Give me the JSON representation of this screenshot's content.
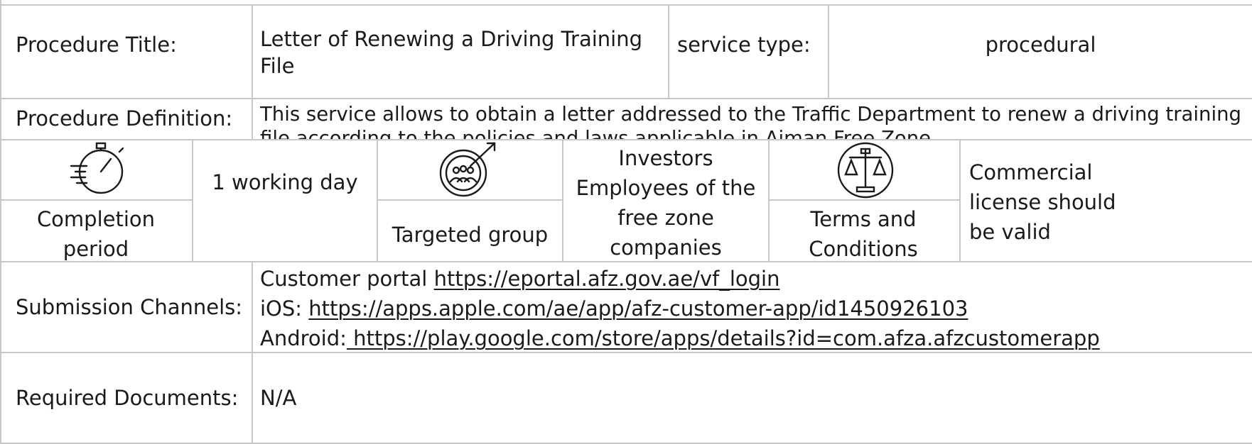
{
  "row_title": {
    "label": "Procedure Title:",
    "value": "Letter of Renewing a Driving Training File",
    "service_type_label": "service type:",
    "service_type_value": "procedural"
  },
  "row_definition": {
    "label": "Procedure Definition:",
    "value": "This service allows to obtain a letter addressed to the Traffic Department to renew a driving training file according to the policies and laws applicable in Ajman Free Zone."
  },
  "row_info": {
    "completion_label": "Completion period",
    "completion_value": "1 working day",
    "targeted_label": "Targeted group",
    "targeted_value_lines": [
      "Investors",
      "Employees of the",
      "free zone",
      "companies"
    ],
    "terms_label": "Terms and Conditions",
    "terms_value_lines": [
      "Commercial",
      "license should",
      "be valid"
    ],
    "icons": [
      "stopwatch-icon",
      "target-group-icon",
      "scales-icon"
    ]
  },
  "row_channels": {
    "label": "Submission Channels:",
    "portal_prefix": "Customer portal ",
    "portal_url": "https://eportal.afz.gov.ae/vf_login",
    "ios_prefix": "iOS: ",
    "ios_url": "https://apps.apple.com/ae/app/afz-customer-app/id1450926103",
    "android_prefix": "Android:",
    "android_url": " https://play.google.com/store/apps/details?id=com.afza.afzcustomerapp"
  },
  "row_documents": {
    "label": "Required Documents:",
    "value": "N/A"
  }
}
